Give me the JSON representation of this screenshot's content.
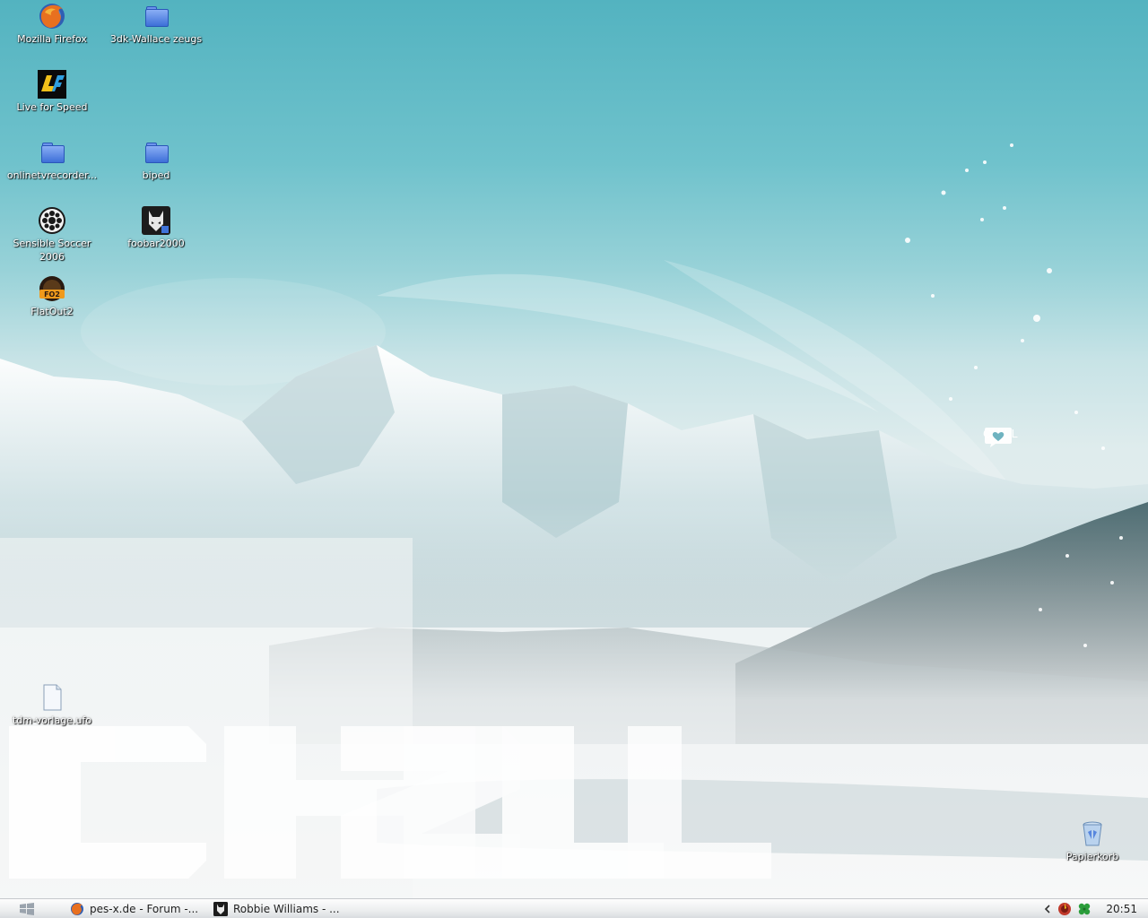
{
  "desktop": {
    "icons": [
      {
        "label": "Mozilla Firefox",
        "icon": "firefox-icon"
      },
      {
        "label": "3dk-Wallace zeugs",
        "icon": "folder-icon"
      },
      {
        "label": "Live for Speed",
        "icon": "live-for-speed-icon"
      },
      {
        "label": "onlinetvrecorder...",
        "icon": "folder-icon"
      },
      {
        "label": "biped",
        "icon": "folder-icon"
      },
      {
        "label": "Sensible Soccer 2006",
        "icon": "sensible-soccer-icon"
      },
      {
        "label": "foobar2000",
        "icon": "foobar2000-icon"
      },
      {
        "label": "FlatOut2",
        "icon": "flatout2-icon"
      },
      {
        "label": "tdm-vorlage.ufo",
        "icon": "document-icon"
      },
      {
        "label": "Papierkorb",
        "icon": "recycle-bin-icon"
      }
    ],
    "wallpaper_badge": "CHILL",
    "wallpaper_title": "CH2LL"
  },
  "taskbar": {
    "tasks": [
      {
        "label": "pes-x.de - Forum -...",
        "icon": "firefox-icon"
      },
      {
        "label": "Robbie  Williams - ...",
        "icon": "foobar2000-icon"
      }
    ],
    "clock": "20:51",
    "tray_icons": [
      "chevron-left-icon",
      "tray-app-icon",
      "clover-icon"
    ]
  }
}
